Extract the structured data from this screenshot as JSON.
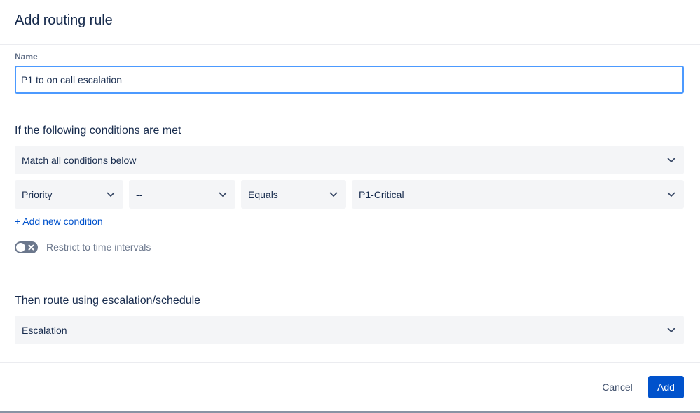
{
  "dialog": {
    "title": "Add routing rule"
  },
  "name_field": {
    "label": "Name",
    "value": "P1 to on call escalation"
  },
  "conditions": {
    "heading": "If the following conditions are met",
    "match_select": "Match all conditions below",
    "row": {
      "field": "Priority",
      "subfield": "--",
      "operator": "Equals",
      "value": "P1-Critical"
    },
    "add_condition": "+ Add new condition",
    "time_toggle_label": "Restrict to time intervals",
    "time_toggle_on": false
  },
  "routing": {
    "heading": "Then route using escalation/schedule",
    "select": "Escalation"
  },
  "footer": {
    "cancel_label": "Cancel",
    "add_label": "Add"
  },
  "colors": {
    "primary": "#0052cc",
    "focus_border": "#4c9aff",
    "select_bg": "#f4f5f7",
    "text": "#172b4d",
    "muted": "#6b778c"
  },
  "icons": {
    "dropdown": "chevron-down-icon",
    "toggle_off": "close-icon"
  }
}
